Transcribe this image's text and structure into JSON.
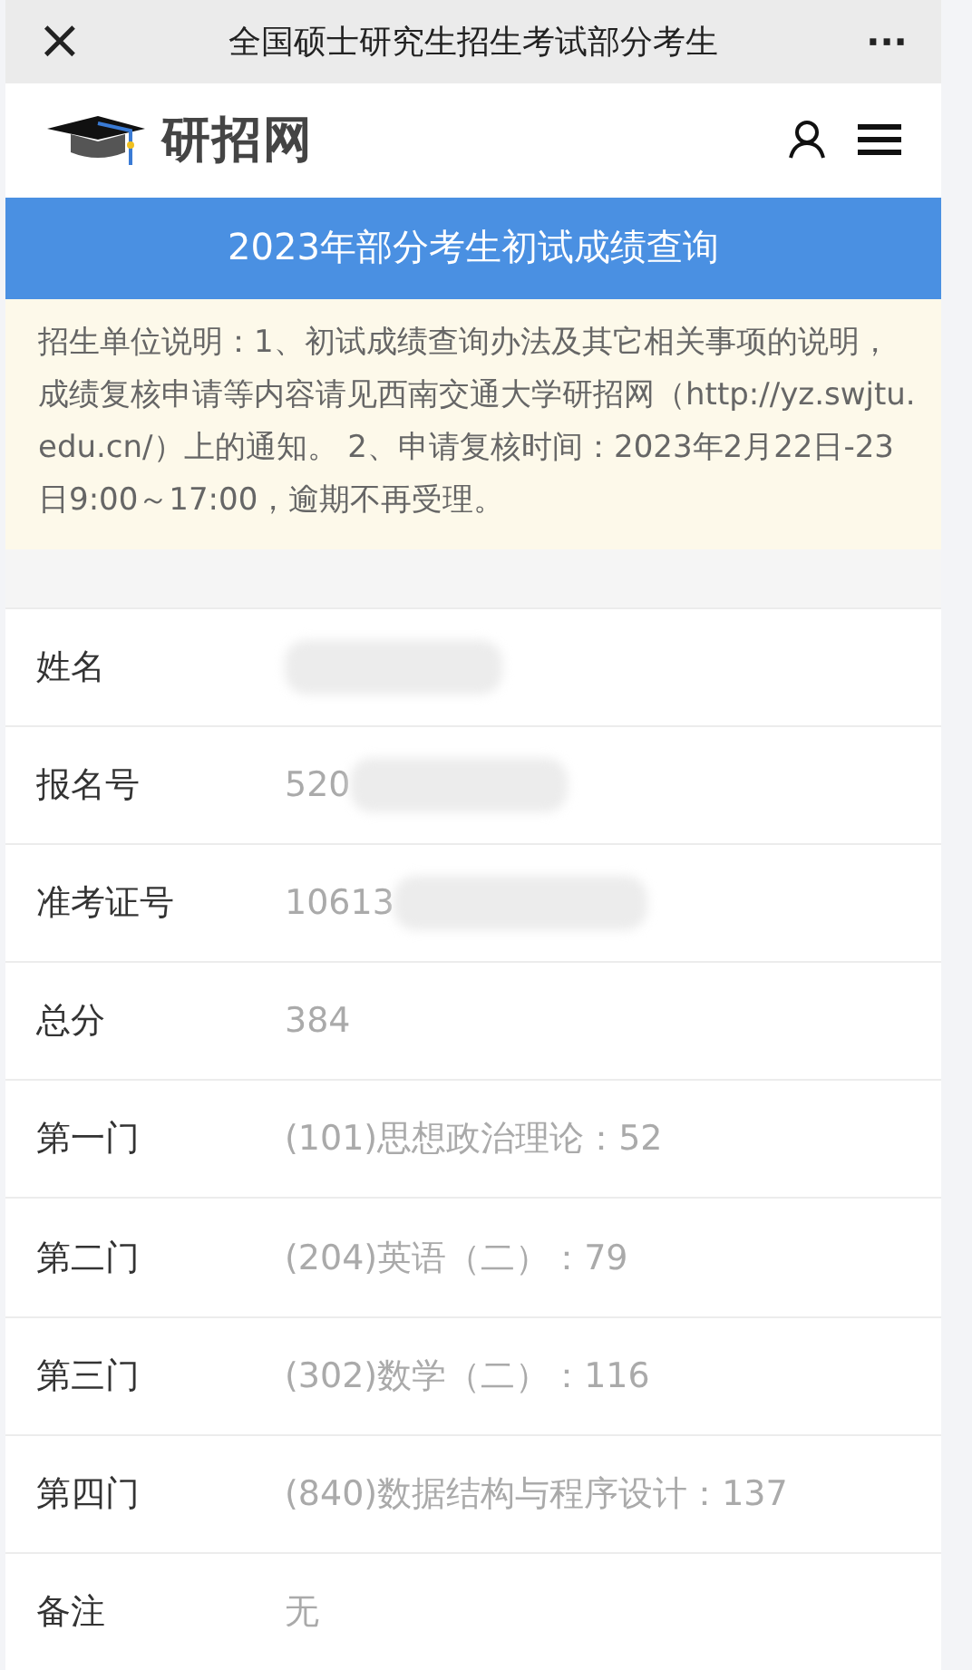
{
  "window": {
    "title": "全国硕士研究生招生考试部分考生",
    "close": "×",
    "more": "···"
  },
  "header": {
    "logo_text": "研招网"
  },
  "banner": {
    "title": "2023年部分考生初试成绩查询"
  },
  "notice": {
    "text": "招生单位说明：1、初试成绩查询办法及其它相关事项的说明，成绩复核申请等内容请见西南交通大学研招网（http://yz.swjtu.edu.cn/）上的通知。 2、申请复核时间：2023年2月22日-23日9:00～17:00，逾期不再受理。"
  },
  "rows": [
    {
      "label": "姓名",
      "value": "",
      "redacted": true
    },
    {
      "label": "报名号",
      "value": "520",
      "redacted": true
    },
    {
      "label": "准考证号",
      "value": "10613",
      "redacted": true
    },
    {
      "label": "总分",
      "value": "384",
      "redacted": false
    },
    {
      "label": "第一门",
      "value": "(101)思想政治理论：52",
      "redacted": false
    },
    {
      "label": "第二门",
      "value": "(204)英语（二）：79",
      "redacted": false
    },
    {
      "label": "第三门",
      "value": "(302)数学（二）：116",
      "redacted": false
    },
    {
      "label": "第四门",
      "value": "(840)数据结构与程序设计：137",
      "redacted": false
    },
    {
      "label": "备注",
      "value": "无",
      "redacted": false
    }
  ]
}
